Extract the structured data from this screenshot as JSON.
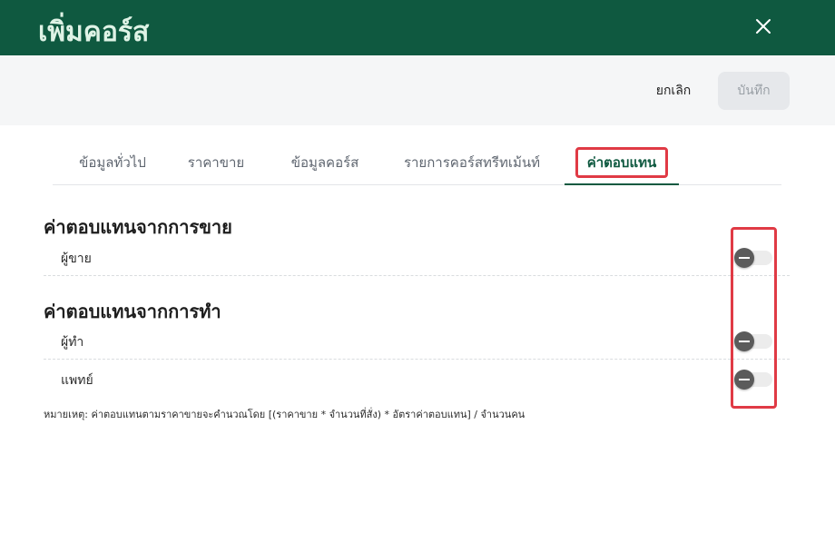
{
  "header": {
    "title": "เพิ่มคอร์ส",
    "close_icon": "close-icon"
  },
  "actions": {
    "cancel_label": "ยกเลิก",
    "save_label": "บันทึก"
  },
  "tabs": [
    {
      "label": "ข้อมูลทั่วไป",
      "active": false
    },
    {
      "label": "ราคาขาย",
      "active": false
    },
    {
      "label": "ข้อมูลคอร์ส",
      "active": false
    },
    {
      "label": "รายการคอร์สทรีทเม้นท์",
      "active": false
    },
    {
      "label": "ค่าตอบแทน",
      "active": true
    }
  ],
  "sections": [
    {
      "title": "ค่าตอบแทนจากการขาย",
      "rows": [
        {
          "label": "ผู้ขาย",
          "toggle": "indeterminate"
        }
      ]
    },
    {
      "title": "ค่าตอบแทนจากการทำ",
      "rows": [
        {
          "label": "ผู้ทำ",
          "toggle": "indeterminate"
        },
        {
          "label": "แพทย์",
          "toggle": "indeterminate"
        }
      ]
    }
  ],
  "note": "หมายเหตุ: ค่าตอบแทนตามราคาขายจะคำนวณโดย [(ราคาขาย * จำนวนที่สั่ง) * อัตราค่าตอบแทน] / จำนวนคน",
  "colors": {
    "header_bg": "#0f5940",
    "header_text": "#dff3e6",
    "highlight": "#e03a45",
    "toggle_knob": "#5b5b5b"
  }
}
